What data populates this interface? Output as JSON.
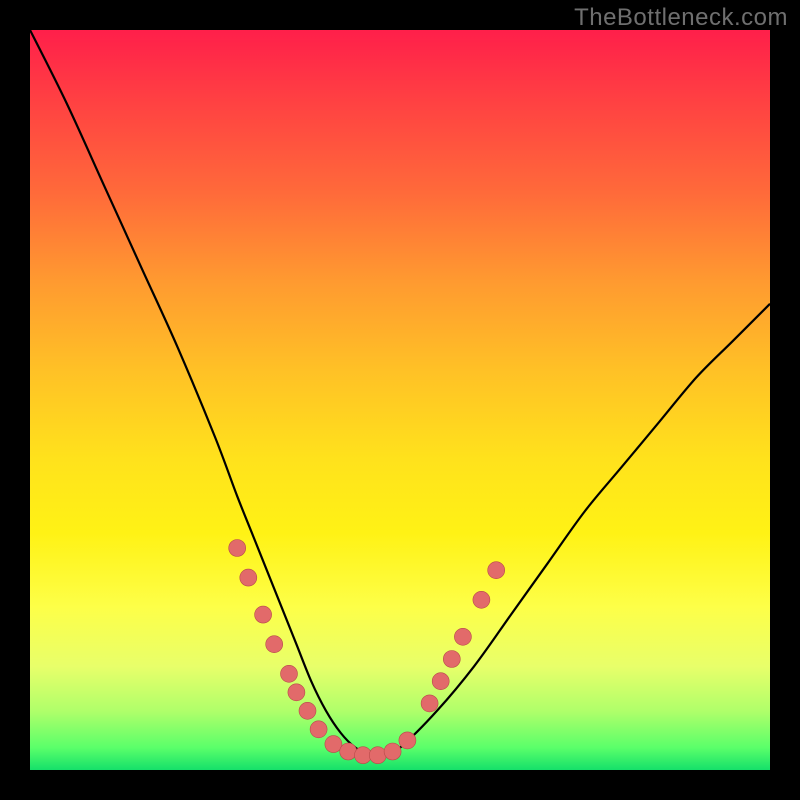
{
  "watermark": {
    "text": "TheBottleneck.com"
  },
  "colors": {
    "curve_stroke": "#000000",
    "marker_fill": "#e26a6a",
    "marker_stroke": "#b84a4a"
  },
  "chart_data": {
    "type": "line",
    "title": "",
    "xlabel": "",
    "ylabel": "",
    "xlim": [
      0,
      100
    ],
    "ylim": [
      0,
      100
    ],
    "grid": false,
    "legend": false,
    "series": [
      {
        "name": "bottleneck-curve",
        "x": [
          0,
          5,
          10,
          15,
          20,
          25,
          28,
          30,
          32,
          34,
          36,
          38,
          40,
          42,
          44,
          46,
          48,
          50,
          55,
          60,
          65,
          70,
          75,
          80,
          85,
          90,
          95,
          100
        ],
        "values": [
          100,
          90,
          79,
          68,
          57,
          45,
          37,
          32,
          27,
          22,
          17,
          12,
          8,
          5,
          3,
          2,
          2,
          3,
          8,
          14,
          21,
          28,
          35,
          41,
          47,
          53,
          58,
          63
        ]
      }
    ],
    "markers": [
      {
        "x": 28.0,
        "y": 30.0
      },
      {
        "x": 29.5,
        "y": 26.0
      },
      {
        "x": 31.5,
        "y": 21.0
      },
      {
        "x": 33.0,
        "y": 17.0
      },
      {
        "x": 35.0,
        "y": 13.0
      },
      {
        "x": 36.0,
        "y": 10.5
      },
      {
        "x": 37.5,
        "y": 8.0
      },
      {
        "x": 39.0,
        "y": 5.5
      },
      {
        "x": 41.0,
        "y": 3.5
      },
      {
        "x": 43.0,
        "y": 2.5
      },
      {
        "x": 45.0,
        "y": 2.0
      },
      {
        "x": 47.0,
        "y": 2.0
      },
      {
        "x": 49.0,
        "y": 2.5
      },
      {
        "x": 51.0,
        "y": 4.0
      },
      {
        "x": 54.0,
        "y": 9.0
      },
      {
        "x": 55.5,
        "y": 12.0
      },
      {
        "x": 57.0,
        "y": 15.0
      },
      {
        "x": 58.5,
        "y": 18.0
      },
      {
        "x": 61.0,
        "y": 23.0
      },
      {
        "x": 63.0,
        "y": 27.0
      }
    ]
  }
}
